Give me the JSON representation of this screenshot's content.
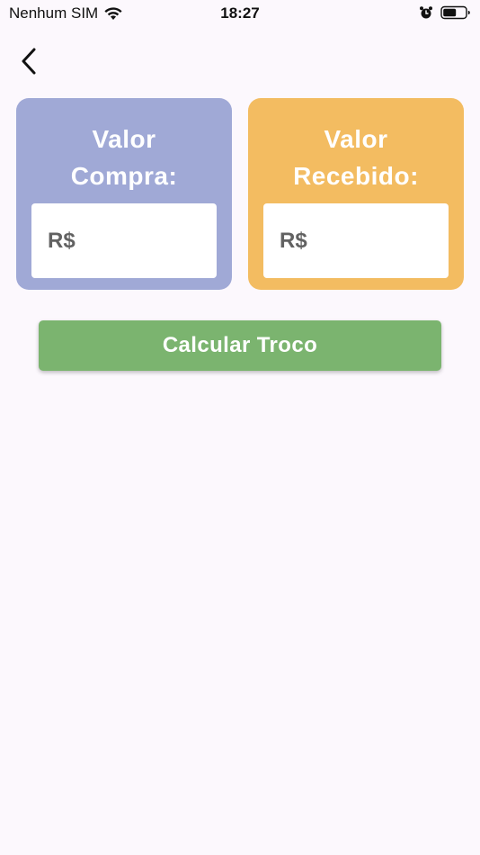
{
  "status_bar": {
    "carrier": "Nenhum SIM",
    "time": "18:27",
    "icons": [
      "wifi-icon",
      "alarm-icon",
      "battery-icon"
    ]
  },
  "nav": {
    "back_icon": "chevron-left-icon"
  },
  "cards": {
    "compra": {
      "title_line1": "Valor",
      "title_line2": "Compra:",
      "placeholder": "R$",
      "value": "",
      "color": "#a0a9d6"
    },
    "recebido": {
      "title_line1": "Valor",
      "title_line2": "Recebido:",
      "placeholder": "R$",
      "value": "",
      "color": "#f3bc61"
    }
  },
  "actions": {
    "calculate_label": "Calcular Troco",
    "color": "#7bb46f"
  },
  "colors": {
    "background": "#fcf8fd",
    "text_white": "#ffffff"
  }
}
